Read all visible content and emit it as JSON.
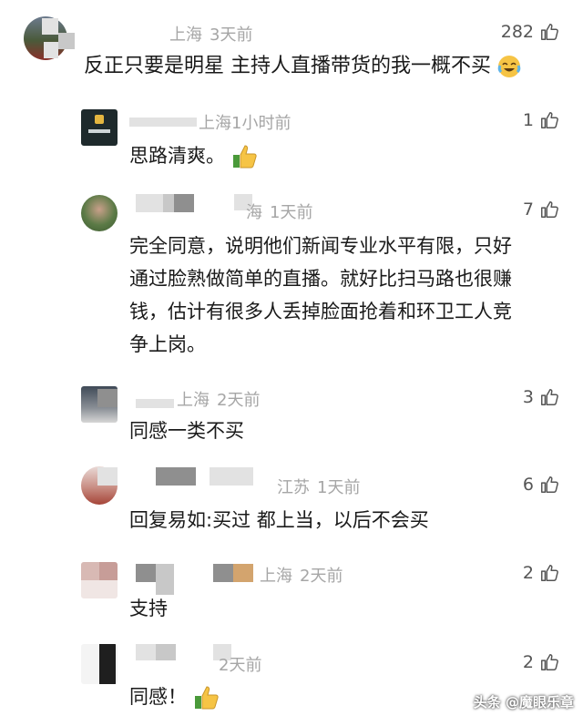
{
  "comments": [
    {
      "location": "上海",
      "time": "3天前",
      "likes": "282",
      "text": "反正只要是明星 主持人直播带货的我一概不买"
    },
    {
      "location": "上海",
      "time": "1小时前",
      "likes": "1",
      "text": "思路清爽。"
    },
    {
      "location": "海",
      "time": "1天前",
      "likes": "7",
      "text_lines": [
        "完全同意，说明他们新闻专业水平有限，只好",
        "通过脸熟做简单的直播。就好比扫马路也很赚",
        "钱，估计有很多人丢掉脸面抢着和环卫工人竞",
        "争上岗。"
      ]
    },
    {
      "location": "上海",
      "time": "2天前",
      "likes": "3",
      "text": "同感一类不买"
    },
    {
      "location": "江苏",
      "time": "1天前",
      "likes": "6",
      "text": "回复易如:买过 都上当，以后不会买"
    },
    {
      "location": "上海",
      "time": "2天前",
      "likes": "2",
      "text": "支持"
    },
    {
      "location": "",
      "time": "2天前",
      "likes": "2",
      "text": "同感！"
    }
  ],
  "watermark": "头条 @魔眼乐章",
  "icons": {
    "like": "thumbs-up-outline-icon",
    "thumbs_emoji": "thumbs-up-emoji-icon",
    "crying_emoji": "laughing-crying-emoji-icon"
  },
  "colors": {
    "meta": "#a6a6a6",
    "text": "#1a1a1a",
    "emoji_yellow": "#f6c445"
  }
}
